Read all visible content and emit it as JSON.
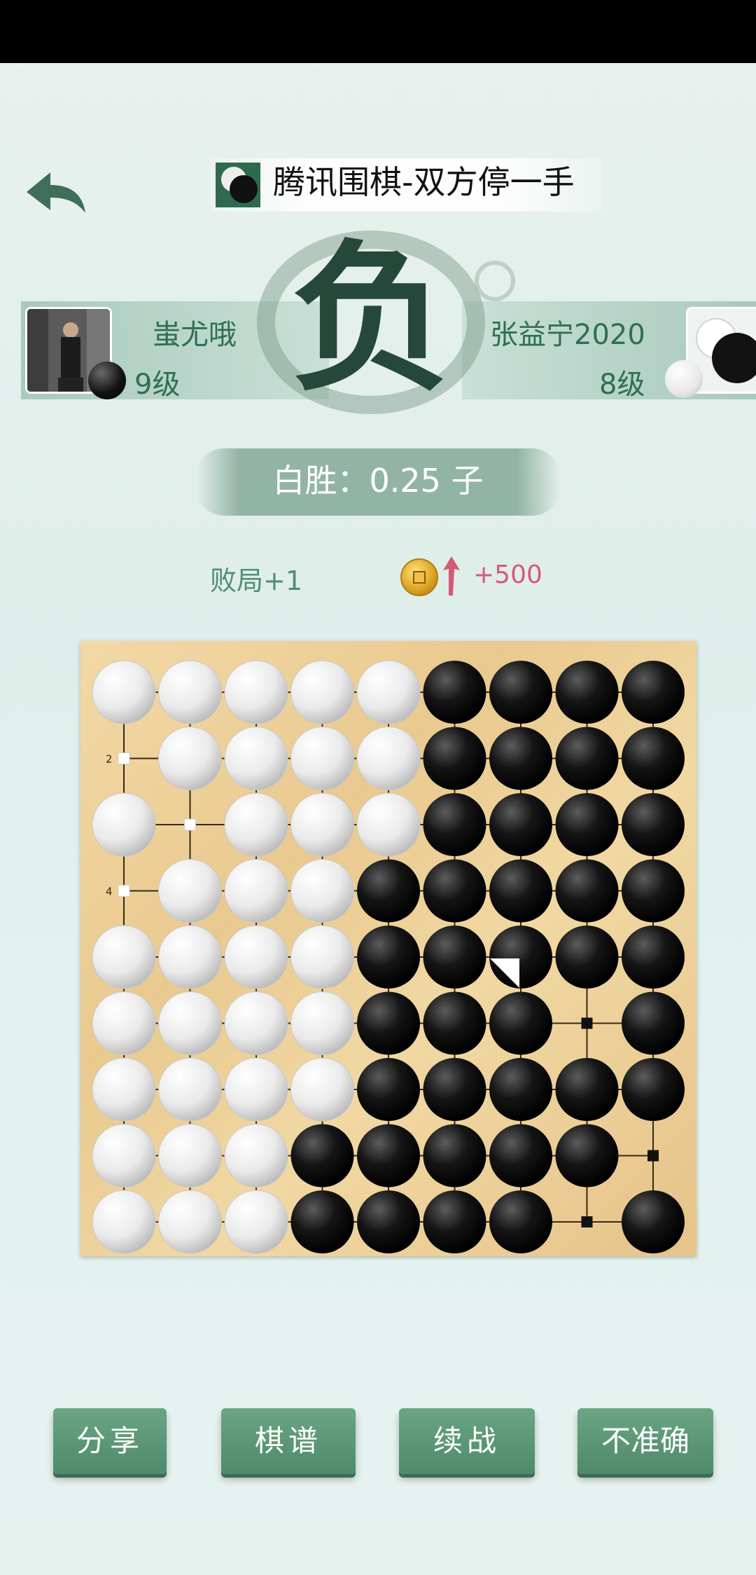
{
  "title": "腾讯围棋-双方停一手",
  "result_mark": "负",
  "result": "白胜：0.25 子",
  "players": {
    "left": {
      "name": "蚩尤哦",
      "rank": "9级",
      "stone": "black"
    },
    "right": {
      "name": "张益宁2020",
      "rank": "8级",
      "stone": "white"
    }
  },
  "rewards": {
    "record": "败局+1",
    "coins": "+500",
    "coin_icon": "copper-coin-icon"
  },
  "board": {
    "size": 9,
    "coord_labels": [
      {
        "row": 1,
        "text": "2"
      },
      {
        "row": 3,
        "text": "4"
      }
    ],
    "rows": [
      "WWWWWBBBB",
      ".WWWWBBBB",
      "W.WWWBBBB",
      ".WWWBBBBB",
      "WWWWBBBBB",
      "WWWWBBB.B",
      "WWWWBBBBB",
      "WWWBBBBB.",
      "WWWBBBB.B"
    ],
    "white_territory": [
      [
        1,
        0
      ],
      [
        2,
        1
      ],
      [
        3,
        0
      ]
    ],
    "black_territory": [
      [
        5,
        7
      ],
      [
        7,
        8
      ],
      [
        8,
        7
      ]
    ],
    "last_move": [
      4,
      6
    ]
  },
  "buttons": [
    "分享",
    "棋谱",
    "续战",
    "不准确"
  ],
  "colors": {
    "accent": "#4e8a6a",
    "text_green": "#2e6f55",
    "coin_text": "#d65a7a"
  }
}
